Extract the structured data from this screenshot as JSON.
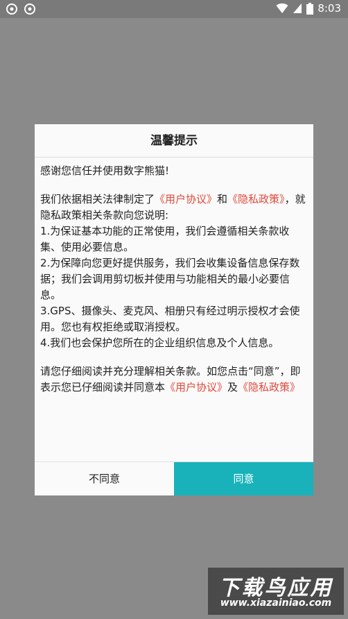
{
  "status_bar": {
    "time": "8:03",
    "left_icons": [
      "app-notification-icon",
      "app-notification-icon"
    ],
    "right_icons": [
      "wifi-icon",
      "signal-icon",
      "battery-icon"
    ]
  },
  "dialog": {
    "title": "温馨提示",
    "greeting": "感谢您信任并使用数字熊猫!",
    "para1_prefix": "我们依据相关法律制定了",
    "user_agreement_link": "《用户协议》",
    "and_text": "和",
    "privacy_link": "《隐私政策》",
    "para1_suffix": "，就隐私政策相关条款向您说明:",
    "item1": "1.为保证基本功能的正常使用，我们会遵循相关条款收集、使用必要信息。",
    "item2": "2.为保障向您更好提供服务，我们会收集设备信息保存数据；我们会调用剪切板并使用与功能相关的最小必要信息。",
    "item3": "3.GPS、摄像头、麦克风、相册只有经过明示授权才会使用。您也有权拒绝或取消授权。",
    "item4": "4.我们也会保护您所在的企业组织信息及个人信息。",
    "para2_prefix": "请您仔细阅读并充分理解相关条款。如您点击“同意”，即表示您已仔细阅读并同意本",
    "and_text2": "及",
    "disagree_button": "不同意",
    "agree_button": "同意"
  },
  "colors": {
    "link": "#e0493b",
    "accent": "#19b2ba",
    "overlay": "#8a8a8a"
  },
  "watermark": {
    "text": "下载鸟应用",
    "url": "www.xiazainiao.com"
  }
}
